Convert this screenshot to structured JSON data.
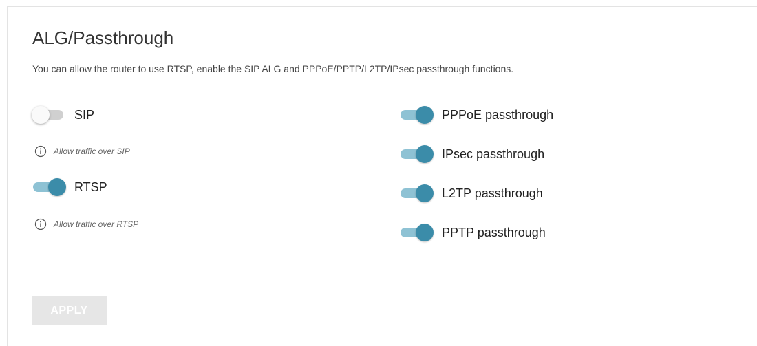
{
  "page": {
    "title": "ALG/Passthrough",
    "description": "You can allow the router to use RTSP, enable the SIP ALG and PPPoE/PPTP/L2TP/IPsec passthrough functions."
  },
  "left_toggles": [
    {
      "label": "SIP",
      "enabled": false,
      "hint": "Allow traffic over SIP"
    },
    {
      "label": "RTSP",
      "enabled": true,
      "hint": "Allow traffic over RTSP"
    }
  ],
  "right_toggles": [
    {
      "label": "PPPoE passthrough",
      "enabled": true
    },
    {
      "label": "IPsec passthrough",
      "enabled": true
    },
    {
      "label": "L2TP passthrough",
      "enabled": true
    },
    {
      "label": "PPTP passthrough",
      "enabled": true
    }
  ],
  "actions": {
    "apply_label": "APPLY",
    "apply_enabled": false
  },
  "colors": {
    "toggle_on_knob": "#3b8ca9",
    "toggle_on_track": "#8ec2d4",
    "toggle_off_track": "#d0d0d0",
    "apply_disabled_bg": "#e6e6e6"
  },
  "icons": {
    "hint_icon": "info-icon"
  }
}
